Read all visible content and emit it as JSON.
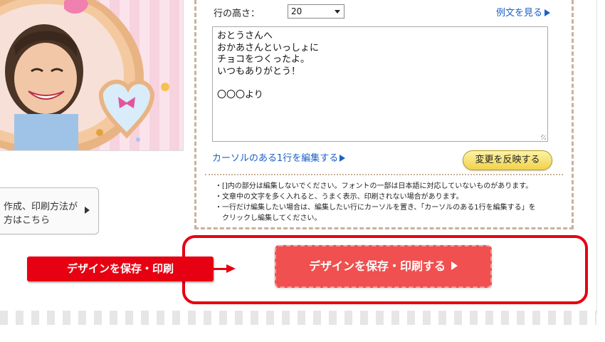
{
  "editor": {
    "line_height_label": "行の高さ：",
    "line_height_value": "20",
    "example_link": "例文を見る",
    "message_lines": [
      "おとうさんへ",
      "おかあさんといっしょに",
      "チョコをつくったよ。",
      "いつもありがとう！",
      "",
      "〇〇〇より"
    ],
    "edit_cursor_line_link": "カーソルのある1行を編集する",
    "apply_button": "変更を反映する",
    "notes": [
      "・[]内の部分は編集しないでください。フォントの一部は日本語に対応していないものがあります。",
      "・文章中の文字を多く入れると、うまく表示、印刷されない場合があります。",
      "・一行だけ編集したい場合は、編集したい行にカーソルを置き、「カーソルのある1行を編集する」を",
      "クリックし編集してください。"
    ]
  },
  "howto": {
    "line1": "作成、印刷方法が",
    "line2": "方はこちら"
  },
  "actions": {
    "save_print_button": "デザインを保存・印刷する",
    "callout_label": "デザインを保存・印刷"
  },
  "colors": {
    "accent_red": "#e60012",
    "button_red": "#f05050",
    "link_blue": "#1a5fc8",
    "apply_yellow": "#f1d24a"
  },
  "icons": {
    "example_arrow": "triangle-right-icon",
    "cursor_arrow": "triangle-right-icon",
    "save_arrow": "triangle-right-icon",
    "howto_arrow": "triangle-right-icon",
    "select_caret": "chevron-down-icon"
  }
}
